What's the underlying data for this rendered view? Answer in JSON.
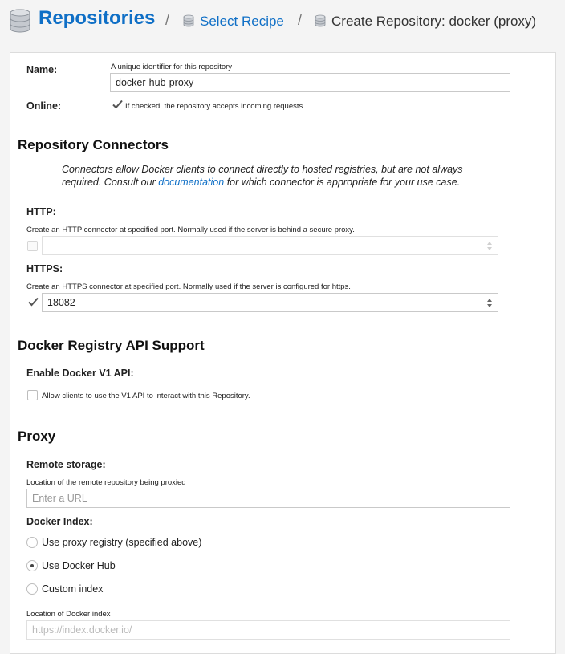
{
  "breadcrumb": {
    "title": "Repositories",
    "separator": "/",
    "recipe_link": "Select Recipe",
    "current": "Create Repository: docker (proxy)"
  },
  "form": {
    "name_label": "Name:",
    "name_help": "A unique identifier for this repository",
    "name_value": "docker-hub-proxy",
    "online_label": "Online:",
    "online_checked": true,
    "online_help": "If checked, the repository accepts incoming requests"
  },
  "connectors": {
    "heading": "Repository Connectors",
    "note_prefix": "Connectors allow Docker clients to connect directly to hosted registries, but are not always required. Consult our ",
    "note_link": "documentation",
    "note_suffix": " for which connector is appropriate for your use case.",
    "http_label": "HTTP:",
    "http_help": "Create an HTTP connector at specified port. Normally used if the server is behind a secure proxy.",
    "http_checked": false,
    "http_value": "",
    "https_label": "HTTPS:",
    "https_help": "Create an HTTPS connector at specified port. Normally used if the server is configured for https.",
    "https_checked": true,
    "https_value": "18082"
  },
  "docker_api": {
    "heading": "Docker Registry API Support",
    "v1_label": "Enable Docker V1 API:",
    "v1_checked": false,
    "v1_help": "Allow clients to use the V1 API to interact with this Repository."
  },
  "proxy": {
    "heading": "Proxy",
    "remote_label": "Remote storage:",
    "remote_help": "Location of the remote repository being proxied",
    "remote_placeholder": "Enter a URL",
    "index_label": "Docker Index:",
    "options": [
      {
        "label": "Use proxy registry (specified above)",
        "selected": false
      },
      {
        "label": "Use Docker Hub",
        "selected": true
      },
      {
        "label": "Custom index",
        "selected": false
      }
    ],
    "index_location_help": "Location of Docker index",
    "index_location_placeholder": "https://index.docker.io/"
  },
  "colors": {
    "link": "#0f6fc6",
    "panel_border": "#dcdcdc",
    "background": "#f4f4f4"
  }
}
